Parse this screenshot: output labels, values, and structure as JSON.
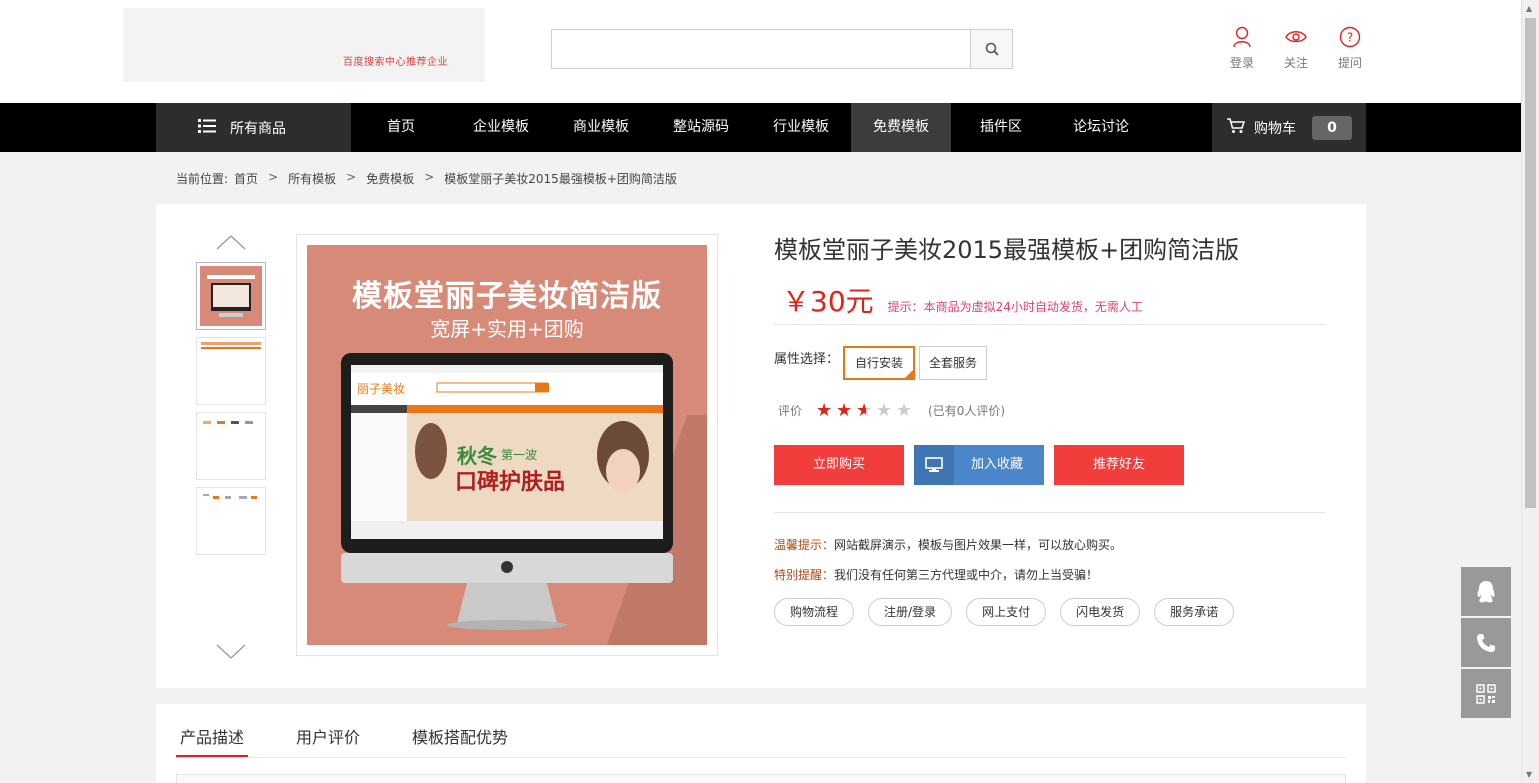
{
  "header": {
    "logo_text": "百度搜索中心推荐企业",
    "search_placeholder": "",
    "user_links": [
      {
        "label": "登录",
        "icon": "user-icon"
      },
      {
        "label": "关注",
        "icon": "eye-icon"
      },
      {
        "label": "提问",
        "icon": "question-icon"
      }
    ]
  },
  "nav": {
    "all_goods": "所有商品",
    "items": [
      "首页",
      "企业模板",
      "商业模板",
      "整站源码",
      "行业模板",
      "免费模板",
      "插件区",
      "论坛讨论"
    ],
    "active_item": "免费模板",
    "cart_label": "购物车",
    "cart_count": "0"
  },
  "breadcrumb": {
    "prefix": "当前位置:",
    "items": [
      "首页",
      "所有模板",
      "免费模板",
      "模板堂丽子美妆2015最强模板+团购简洁版"
    ]
  },
  "product": {
    "image_title": "模板堂丽子美妆简洁版",
    "image_subtitle": "宽屏+实用+团购",
    "title": "模板堂丽子美妆2015最强模板+团购简洁版",
    "price": "￥30元",
    "tip": "提示：本商品为虚拟24小时自动发货，无需人工",
    "attr_label": "属性选择：",
    "attr_options": [
      "自行安装",
      "全套服务"
    ],
    "attr_selected": "自行安装",
    "rating_label": "评价",
    "rating_value": 2.5,
    "rating_max": 5,
    "rating_note": "(已有0人评价)",
    "buttons": {
      "buy": "立即购买",
      "favorite": "加入收藏",
      "recommend": "推荐好友"
    },
    "notes": [
      {
        "key": "温馨提示：",
        "text": "网站截屏演示，模板与图片效果一样，可以放心购买。"
      },
      {
        "key": "特别提醒：",
        "text": "我们没有任何第三方代理或中介，请勿上当受骗！"
      }
    ],
    "pills": [
      "购物流程",
      "注册/登录",
      "网上支付",
      "闪电发货",
      "服务承诺"
    ]
  },
  "tabs": {
    "items": [
      "产品描述",
      "用户评价",
      "模板搭配优势"
    ],
    "active": "产品描述"
  },
  "colors": {
    "accent_red": "#f23d3d",
    "accent_blue": "#4a86c8",
    "selected_orange": "#e87817",
    "nav_bg": "#000000",
    "image_bg": "#d78a78"
  }
}
